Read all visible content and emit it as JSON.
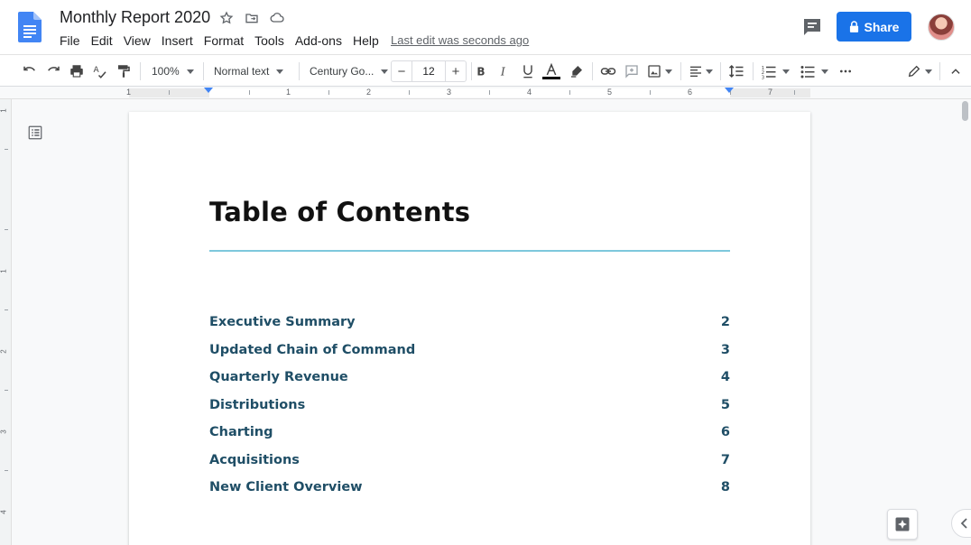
{
  "document": {
    "title": "Monthly Report 2020",
    "last_edit": "Last edit was seconds ago"
  },
  "menu": [
    "File",
    "Edit",
    "View",
    "Insert",
    "Format",
    "Tools",
    "Add-ons",
    "Help"
  ],
  "share_label": "Share",
  "toolbar": {
    "zoom": "100%",
    "style": "Normal text",
    "font": "Century Go...",
    "font_size": "12",
    "text_color": "#000000",
    "icons": [
      "undo-icon",
      "redo-icon",
      "print-icon",
      "spellcheck-icon",
      "paint-format-icon",
      "bold-icon",
      "italic-icon",
      "underline-icon",
      "text-color-icon",
      "highlight-icon",
      "link-icon",
      "comment-icon",
      "image-icon",
      "align-icon",
      "line-spacing-icon",
      "numbered-list-icon",
      "bulleted-list-icon",
      "more-icon",
      "editing-mode-icon",
      "collapse-icon"
    ]
  },
  "ruler": {
    "numbers": [
      "1",
      "1",
      "2",
      "3",
      "4",
      "5",
      "6",
      "7"
    ],
    "vertical_numbers": [
      "1",
      "1",
      "2",
      "3",
      "4"
    ]
  },
  "page": {
    "heading": "Table of Contents",
    "toc": [
      {
        "label": "Executive Summary",
        "page": "2"
      },
      {
        "label": "Updated Chain of Command",
        "page": "3"
      },
      {
        "label": "Quarterly Revenue",
        "page": "4"
      },
      {
        "label": "Distributions",
        "page": "5"
      },
      {
        "label": "Charting",
        "page": "6"
      },
      {
        "label": "Acquisitions",
        "page": "7"
      },
      {
        "label": "New Client Overview",
        "page": "8"
      }
    ]
  },
  "colors": {
    "accent": "#1a73e8",
    "toc_text": "#1f4e66",
    "rule": "#7ec8dc",
    "docs_blue": "#4285f4"
  }
}
